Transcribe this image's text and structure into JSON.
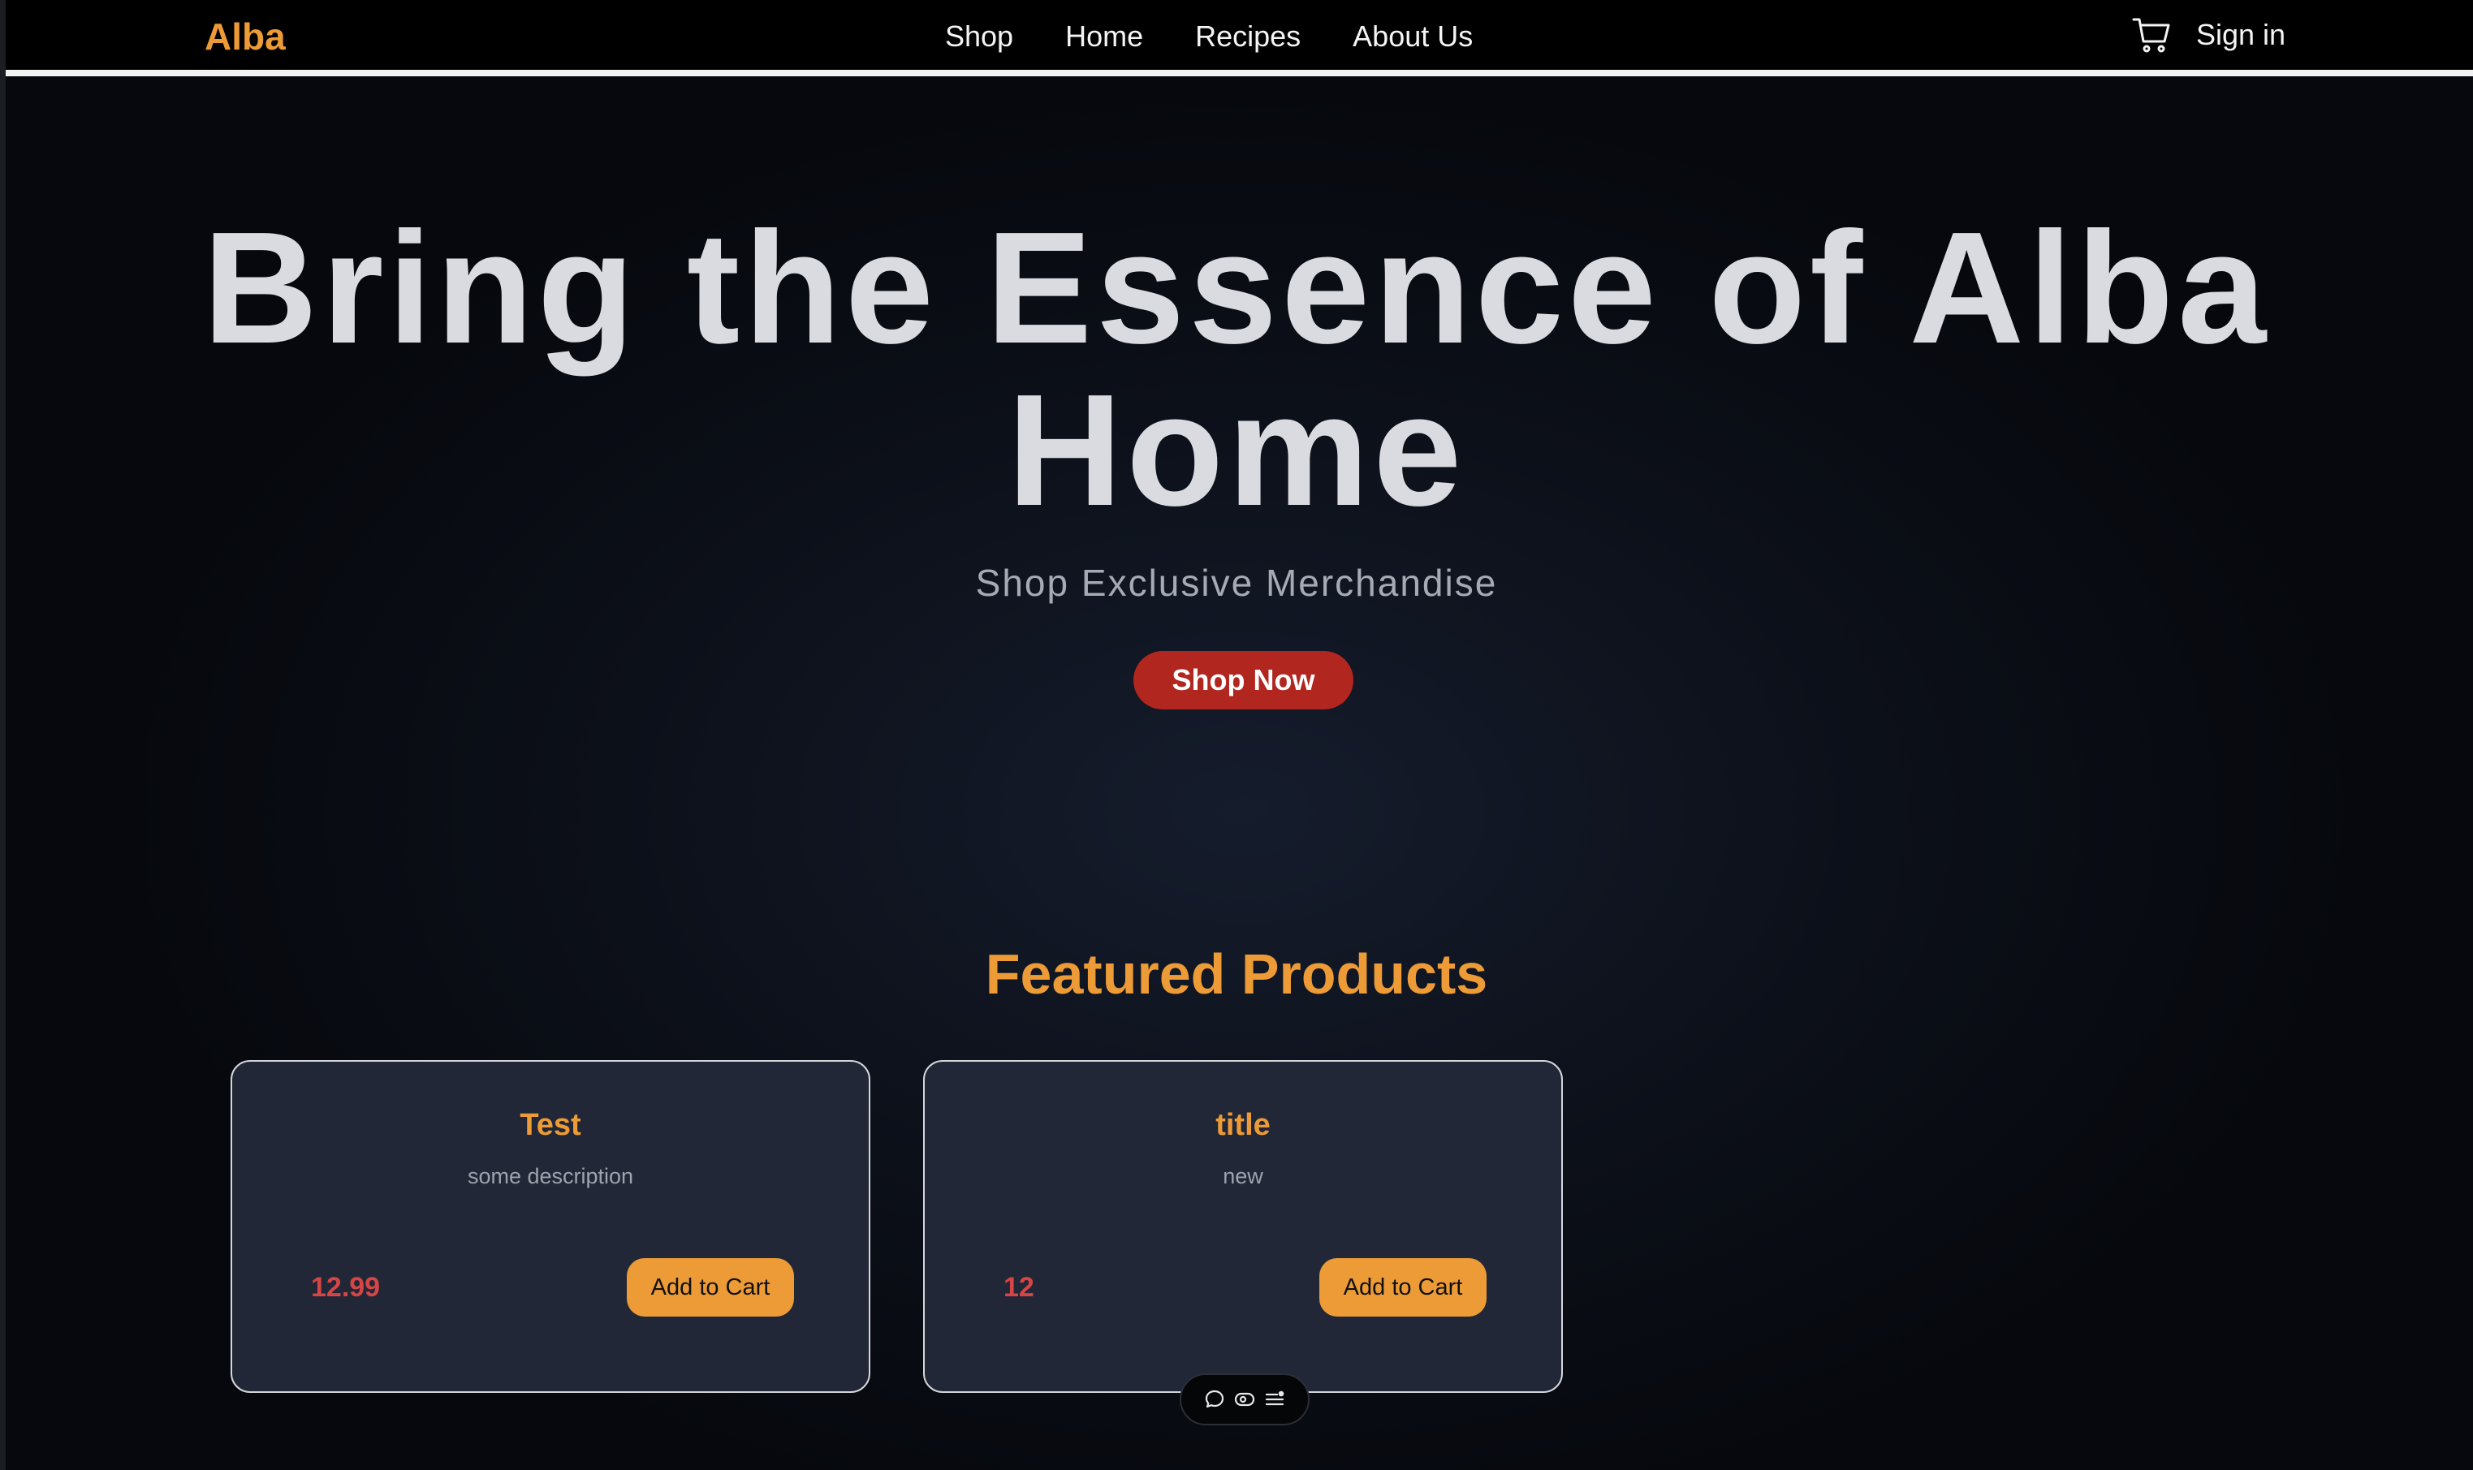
{
  "navbar": {
    "brand": "Alba",
    "links": [
      "Shop",
      "Home",
      "Recipes",
      "About Us"
    ],
    "cart_icon": "cart-icon",
    "signin_label": "Sign in"
  },
  "hero": {
    "title_line1": "Bring the Essence of Alba",
    "title_line2": "Home",
    "subtitle": "Shop Exclusive Merchandise",
    "cta_label": "Shop Now"
  },
  "featured": {
    "heading": "Featured Products",
    "products": [
      {
        "title": "Test",
        "description": "some description",
        "price": "12.99",
        "button_label": "Add to Cart"
      },
      {
        "title": "title",
        "description": "new",
        "price": "12",
        "button_label": "Add to Cart"
      }
    ]
  },
  "toolbar": {
    "icons": [
      "comment-icon",
      "eye-icon",
      "list-settings-icon"
    ]
  },
  "colors": {
    "accent": "#ec9b36",
    "cta": "#b1261f",
    "price": "#d64545",
    "card_bg": "#212736"
  }
}
